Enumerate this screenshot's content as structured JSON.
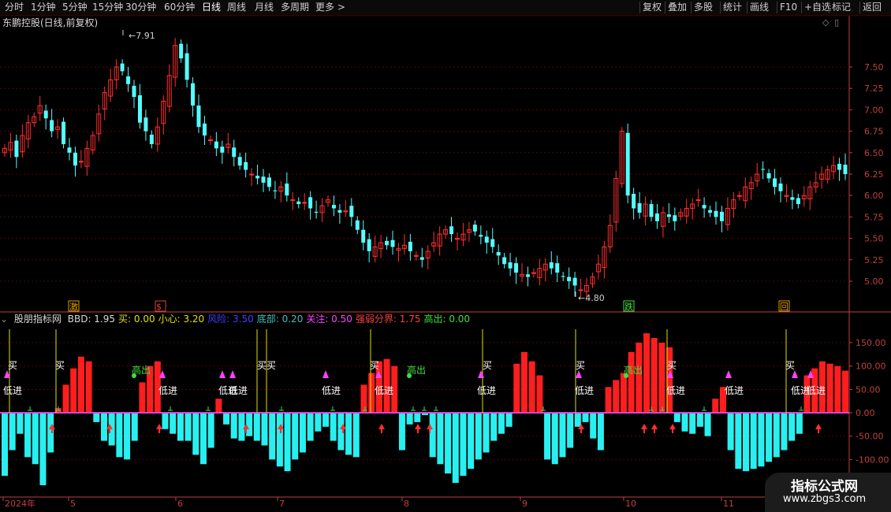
{
  "toolbar": {
    "left": [
      "分时",
      "1分钟",
      "5分钟",
      "15分钟",
      "30分钟",
      "60分钟",
      "日线",
      "周线",
      "月线",
      "多周期",
      "更多 >"
    ],
    "right": [
      "复权",
      "叠加",
      "多股",
      "统计",
      "画线",
      "F10",
      "+自选",
      "标记",
      "返回"
    ],
    "active_index": 6
  },
  "main_chart": {
    "title": "东鹏控股(日线,前复权)",
    "high_marker": "7.91",
    "low_marker": "4.80",
    "y_ticks": [
      "7.50",
      "7.25",
      "7.00",
      "6.75",
      "6.50",
      "6.25",
      "6.00",
      "5.75",
      "5.50",
      "5.25",
      "5.00"
    ],
    "events": [
      {
        "label": "激",
        "color": "#e0a000"
      },
      {
        "label": "$",
        "color": "#e04040"
      },
      {
        "label": "跌",
        "color": "#40e040"
      },
      {
        "label": "回",
        "color": "#e0a000"
      }
    ],
    "colors": {
      "up": "#ff3030",
      "down": "#54ffff",
      "grid": "#5a0000",
      "axis": "#c04040"
    }
  },
  "indicator": {
    "name": "股朋指标网",
    "params": [
      {
        "label": "BBD: 1.95",
        "color": "#d8d8d8"
      },
      {
        "label": "买: 0.00",
        "color": "#e0e000"
      },
      {
        "label": "小心: 3.20",
        "color": "#e0e000"
      },
      {
        "label": "风险: 3.50",
        "color": "#4040ff"
      },
      {
        "label": "底部: 0.20",
        "color": "#40c0c0"
      },
      {
        "label": "关注: 0.50",
        "color": "#ff40ff"
      },
      {
        "label": "强弱分界: 1.75",
        "color": "#ff4040"
      },
      {
        "label": "高出: 0.00",
        "color": "#40e040"
      }
    ],
    "y_ticks": [
      "150.00",
      "100.00",
      "50.00",
      "0.00",
      "-50.00",
      "-100.00"
    ],
    "signals": {
      "buy": "买",
      "low_in": "低进",
      "high_out": "高出"
    }
  },
  "dates": [
    "2024年",
    "5",
    "6",
    "7",
    "8",
    "9",
    "10",
    "11"
  ],
  "watermark": {
    "line1": "指标公式网",
    "line2": "www.zbgs3.com"
  },
  "chart_data": {
    "type": "candlestick",
    "title": "东鹏控股(日线,前复权)",
    "ylim": [
      4.8,
      7.91
    ],
    "close_series": [
      6.55,
      6.62,
      6.45,
      6.7,
      6.85,
      6.92,
      7.05,
      6.9,
      6.75,
      6.8,
      6.6,
      6.5,
      6.35,
      6.4,
      6.55,
      6.7,
      6.95,
      7.2,
      7.35,
      7.5,
      7.45,
      7.3,
      7.15,
      6.85,
      6.75,
      6.6,
      6.8,
      7.1,
      7.4,
      7.75,
      7.6,
      7.35,
      7.05,
      6.8,
      6.7,
      6.65,
      6.55,
      6.5,
      6.6,
      6.45,
      6.35,
      6.3,
      6.25,
      6.2,
      6.15,
      6.1,
      6.05,
      6.1,
      6.0,
      5.95,
      5.9,
      5.92,
      5.85,
      5.8,
      5.88,
      5.95,
      5.85,
      5.8,
      5.82,
      5.75,
      5.6,
      5.45,
      5.35,
      5.4,
      5.45,
      5.42,
      5.4,
      5.38,
      5.42,
      5.35,
      5.3,
      5.25,
      5.35,
      5.45,
      5.55,
      5.6,
      5.55,
      5.5,
      5.55,
      5.6,
      5.58,
      5.52,
      5.45,
      5.4,
      5.3,
      5.2,
      5.15,
      5.1,
      5.08,
      5.05,
      5.1,
      5.15,
      5.2,
      5.15,
      5.1,
      5.05,
      5.0,
      4.95,
      4.9,
      4.95,
      5.05,
      5.2,
      5.4,
      5.65,
      6.2,
      6.75,
      6.0,
      5.85,
      5.8,
      5.9,
      5.75,
      5.7,
      5.8,
      5.75,
      5.7,
      5.8,
      5.85,
      5.9,
      5.95,
      5.85,
      5.8,
      5.75,
      5.7,
      5.85,
      5.95,
      6.0,
      6.1,
      6.15,
      6.25,
      6.3,
      6.2,
      6.1,
      6.05,
      6.0,
      5.95,
      5.9,
      6.0,
      6.1,
      6.15,
      6.25,
      6.3,
      6.35,
      6.3,
      6.25
    ],
    "indicator_values": [
      -135,
      -80,
      -45,
      -95,
      -110,
      -155,
      -85,
      10,
      60,
      95,
      120,
      110,
      -20,
      -60,
      -70,
      -95,
      -100,
      -60,
      65,
      100,
      110,
      -35,
      -45,
      -60,
      -60,
      -90,
      -110,
      -75,
      30,
      -25,
      -55,
      -60,
      -50,
      -60,
      -70,
      -100,
      -115,
      -125,
      -100,
      -85,
      -60,
      -40,
      -30,
      -60,
      -80,
      -90,
      -95,
      60,
      85,
      110,
      115,
      100,
      -80,
      -25,
      -20,
      -5,
      -95,
      -110,
      -130,
      -150,
      -135,
      -120,
      -100,
      -85,
      -60,
      -45,
      -30,
      105,
      130,
      110,
      80,
      -100,
      -110,
      -95,
      -75,
      -30,
      -20,
      -55,
      -80,
      55,
      70,
      85,
      130,
      150,
      170,
      160,
      150,
      140,
      -20,
      -40,
      -45,
      -30,
      -50,
      30,
      55,
      -80,
      -120,
      -125,
      -120,
      -115,
      -105,
      -95,
      -80,
      -60,
      -45,
      80,
      95,
      110,
      105,
      100,
      90
    ],
    "ind_ylim": [
      -170,
      175
    ],
    "x_labels": [
      "2024年",
      "5",
      "6",
      "7",
      "8",
      "9",
      "10",
      "11"
    ]
  }
}
